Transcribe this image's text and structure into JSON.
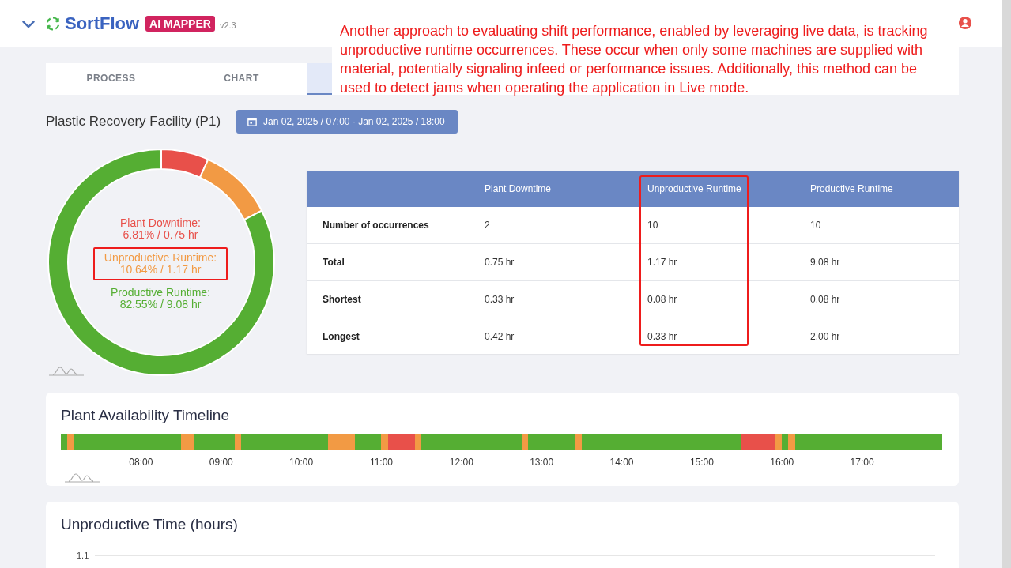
{
  "header": {
    "app_name": "SortFlow",
    "badge": "AI MAPPER",
    "version": "v2.3"
  },
  "annotation": {
    "text": "Another approach to evaluating shift performance, enabled by leveraging live data, is tracking unproductive runtime occurrences. These occur when only some machines are supplied with material, potentially signaling infeed or performance issues. Additionally, this method can be used to detect jams when operating the application in Live mode."
  },
  "tabs": [
    {
      "label": "PROCESS",
      "selected": false
    },
    {
      "label": "CHART",
      "selected": false
    },
    {
      "selected": true
    }
  ],
  "facility": {
    "title": "Plastic Recovery Facility (P1)",
    "date_range": "Jan 02, 2025 / 07:00 - Jan 02, 2025 / 18:00"
  },
  "donut": {
    "legend": [
      {
        "label": "Plant Downtime:",
        "value": "6.81% / 0.75 hr",
        "color": "#e8504a",
        "highlighted": false
      },
      {
        "label": "Unproductive Runtime:",
        "value": "10.64% / 1.17 hr",
        "color": "#f29a44",
        "highlighted": true
      },
      {
        "label": "Productive Runtime:",
        "value": "82.55% / 9.08 hr",
        "color": "#55ae33",
        "highlighted": false
      }
    ],
    "chart_data": {
      "type": "donut",
      "values": [
        6.81,
        10.64,
        82.55
      ]
    }
  },
  "table": {
    "columns": [
      {
        "label": "Plant Downtime",
        "highlighted": false
      },
      {
        "label": "Unproductive Runtime",
        "highlighted": true
      },
      {
        "label": "Productive Runtime",
        "highlighted": false
      }
    ],
    "rows": [
      {
        "label": "Number of occurrences",
        "cells": [
          "2",
          "10",
          "10"
        ]
      },
      {
        "label": "Total",
        "cells": [
          "0.75 hr",
          "1.17 hr",
          "9.08 hr"
        ]
      },
      {
        "label": "Shortest",
        "cells": [
          "0.33 hr",
          "0.08 hr",
          "0.08 hr"
        ]
      },
      {
        "label": "Longest",
        "cells": [
          "0.42 hr",
          "0.33 hr",
          "2.00 hr"
        ]
      }
    ]
  },
  "timeline": {
    "title": "Plant Availability Timeline",
    "ticks": [
      "08:00",
      "09:00",
      "10:00",
      "11:00",
      "12:00",
      "13:00",
      "14:00",
      "15:00",
      "16:00",
      "17:00"
    ]
  },
  "unproductive_chart": {
    "title": "Unproductive Time (hours)",
    "y_tick": "1.1"
  }
}
